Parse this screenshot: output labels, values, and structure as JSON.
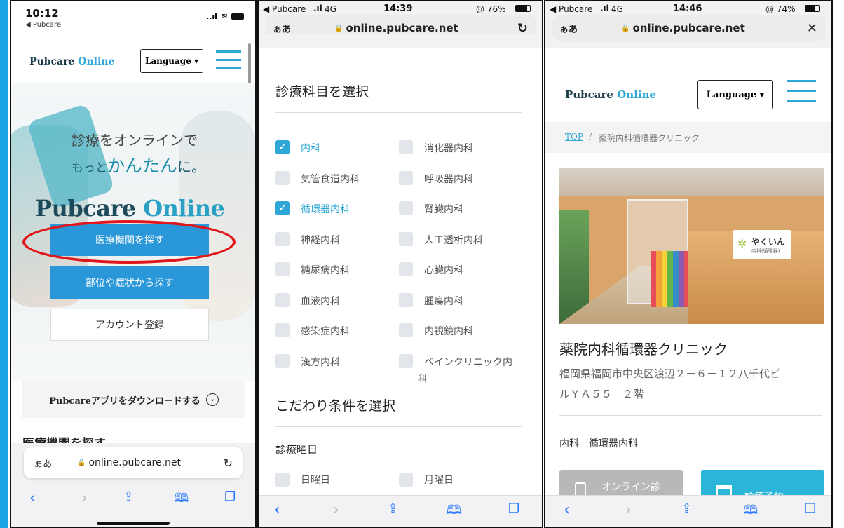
{
  "panel1": {
    "status": {
      "time": "10:12",
      "back_app": "◀ Pubcare",
      "signal": "..ıl"
    },
    "header": {
      "logo_main": "Pubcare",
      "logo_accent": "Online",
      "language_label": "Language ▾"
    },
    "hero": {
      "line1": "診療をオンラインで",
      "line2_a": "もっと",
      "line2_b": "かんたん",
      "line2_c": "に。",
      "brand_main": "Pubcare",
      "brand_accent": "Online"
    },
    "buttons": {
      "find_clinic": "医療機関を探す",
      "find_symptom": "部位や症状から探す",
      "register": "アカウント登録"
    },
    "download": {
      "label": "Pubcareアプリをダウンロードする"
    },
    "section_title": "医療機関を探す",
    "url": {
      "aa": "ぁあ",
      "domain": "online.pubcare.net"
    }
  },
  "panel2": {
    "status": {
      "carrier": "◀ Pubcare",
      "network": "4G",
      "time": "14:39",
      "battery": "@ 76%"
    },
    "url": {
      "aa": "ぁあ",
      "domain": "online.pubcare.net"
    },
    "dept_title": "診療科目を選択",
    "departments": [
      {
        "label": "内科",
        "checked": true
      },
      {
        "label": "消化器内科",
        "checked": false
      },
      {
        "label": "気管食道内科",
        "checked": false
      },
      {
        "label": "呼吸器内科",
        "checked": false
      },
      {
        "label": "循環器内科",
        "checked": true
      },
      {
        "label": "腎臓内科",
        "checked": false
      },
      {
        "label": "神経内科",
        "checked": false
      },
      {
        "label": "人工透析内科",
        "checked": false
      },
      {
        "label": "糖尿病内科",
        "checked": false
      },
      {
        "label": "心臓内科",
        "checked": false
      },
      {
        "label": "血液内科",
        "checked": false
      },
      {
        "label": "腫瘍内科",
        "checked": false
      },
      {
        "label": "感染症内科",
        "checked": false
      },
      {
        "label": "内視鏡内科",
        "checked": false
      },
      {
        "label": "漢方内科",
        "checked": false
      },
      {
        "label": "ペインクリニック内",
        "checked": false
      }
    ],
    "dept_wrap_tail": "科",
    "cond_title": "こだわり条件を選択",
    "days_title": "診療曜日",
    "days": [
      {
        "label": "日曜日"
      },
      {
        "label": "月曜日"
      }
    ]
  },
  "panel3": {
    "status": {
      "carrier": "◀ Pubcare",
      "network": "4G",
      "time": "14:46",
      "battery": "@ 74%"
    },
    "url": {
      "aa": "ぁあ",
      "domain": "online.pubcare.net",
      "close": "✕"
    },
    "header": {
      "logo_main": "Pubcare",
      "logo_accent": "Online",
      "language_label": "Language ▾"
    },
    "breadcrumb": {
      "top": "TOP",
      "sep": "/",
      "current": "薬院内科循環器クリニック"
    },
    "photo_sign": {
      "name": "やくいん",
      "sub": "内科(循環器)"
    },
    "clinic_name": "薬院内科循環器クリニック",
    "address_line1": "福岡県福岡市中央区渡辺２－６－１２八千代ビ",
    "address_line2": "ルＹＡ５５　２階",
    "departments": "内科　循環器内科",
    "btn_online": "オンライン診",
    "btn_reserve": "診療予約"
  },
  "colors": {
    "accent": "#2ea7d6",
    "button_blue": "#2a97d8",
    "frame_blue": "#1ba3e6",
    "highlight_red": "#e0161b"
  },
  "icons": [
    "signal-icon",
    "wifi-icon",
    "battery-icon",
    "lock-icon",
    "reload-icon",
    "hamburger-icon",
    "chevron-down-circle-icon",
    "back-icon",
    "forward-icon",
    "share-icon",
    "bookmarks-icon",
    "tabs-icon",
    "close-icon"
  ]
}
